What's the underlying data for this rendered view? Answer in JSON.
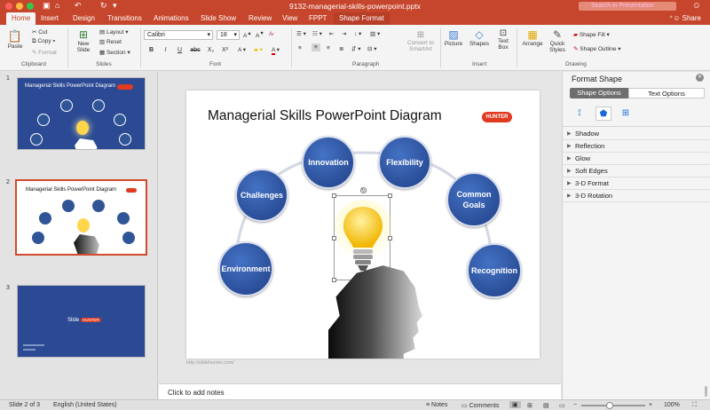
{
  "window": {
    "title": "9132-managerial-skills-powerpoint.pptx",
    "search_placeholder": "Search in Presentation"
  },
  "tabs": [
    {
      "label": "Home",
      "active": true
    },
    {
      "label": "Insert"
    },
    {
      "label": "Design"
    },
    {
      "label": "Transitions"
    },
    {
      "label": "Animations"
    },
    {
      "label": "Slide Show"
    },
    {
      "label": "Review"
    },
    {
      "label": "View"
    },
    {
      "label": "FPPT"
    },
    {
      "label": "Shape Format",
      "contextual": true
    }
  ],
  "share_label": "Share",
  "ribbon": {
    "paste": "Paste",
    "cut": "Cut",
    "copy": "Copy",
    "format": "Format",
    "clipboard": "Clipboard",
    "new_slide": "New\nSlide",
    "layout": "Layout",
    "reset": "Reset",
    "section": "Section",
    "slides": "Slides",
    "font_name": "Calibri",
    "font_size": "18",
    "font": "Font",
    "paragraph": "Paragraph",
    "convert_smartart": "Convert to\nSmartArt",
    "picture": "Picture",
    "shapes": "Shapes",
    "text_box": "Text\nBox",
    "insert": "Insert",
    "arrange": "Arrange",
    "quick_styles": "Quick\nStyles",
    "shape_fill": "Shape Fill",
    "shape_outline": "Shape Outline",
    "drawing": "Drawing",
    "font_buttons": [
      "B",
      "I",
      "U",
      "abc",
      "X₂",
      "X²"
    ]
  },
  "thumbnails": [
    {
      "number": "1",
      "title": "Managerial Skills PowerPoint Diagram"
    },
    {
      "number": "2",
      "title": "Managerial Skills PowerPoint Diagram",
      "selected": true
    },
    {
      "number": "3",
      "brand": "Slide",
      "brand_badge": "HUNTER"
    }
  ],
  "slide": {
    "title": "Managerial Skills PowerPoint Diagram",
    "logo": "HUNTER",
    "url": "http://slidehunter.com/",
    "circles": [
      {
        "label": "Environment"
      },
      {
        "label": "Challenges"
      },
      {
        "label": "Innovation"
      },
      {
        "label": "Flexibility"
      },
      {
        "label": "Common Goals"
      },
      {
        "label": "Recognition"
      }
    ]
  },
  "notes_placeholder": "Click to add notes",
  "format_pane": {
    "title": "Format Shape",
    "tab_shape": "Shape Options",
    "tab_text": "Text Options",
    "sections": [
      "Shadow",
      "Reflection",
      "Glow",
      "Soft Edges",
      "3-D Format",
      "3-D Rotation"
    ]
  },
  "status": {
    "slide": "Slide 2 of 3",
    "language": "English (United States)",
    "notes": "Notes",
    "comments": "Comments",
    "zoom": "100%"
  },
  "colors": {
    "accent": "#c6462d",
    "circle_fill": "#2f5597",
    "logo": "#e03a20"
  }
}
